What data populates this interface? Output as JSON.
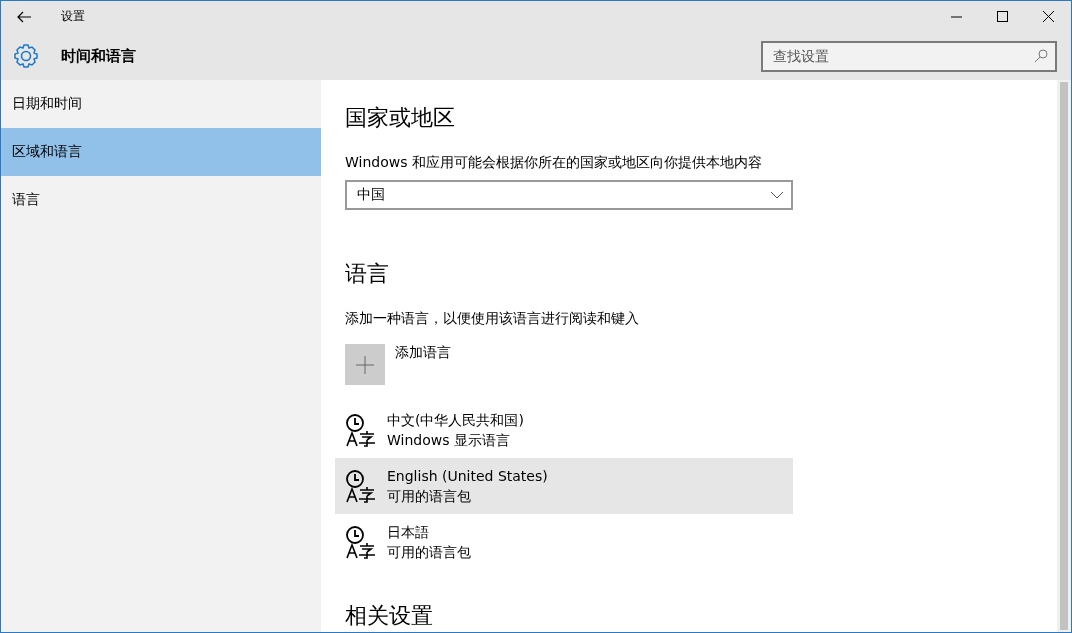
{
  "window": {
    "title": "设置"
  },
  "header": {
    "title": "时间和语言",
    "search": {
      "placeholder": "查找设置"
    }
  },
  "sidebar": {
    "items": [
      {
        "label": "日期和时间",
        "selected": false
      },
      {
        "label": "区域和语言",
        "selected": true
      },
      {
        "label": "语言",
        "selected": false
      }
    ]
  },
  "region": {
    "heading": "国家或地区",
    "description": "Windows 和应用可能会根据你所在的国家或地区向你提供本地内容",
    "dropdown": {
      "value": "中国"
    }
  },
  "language": {
    "heading": "语言",
    "description": "添加一种语言，以便使用该语言进行阅读和键入",
    "add_button": "添加语言",
    "items": [
      {
        "name": "中文(中华人民共和国)",
        "status": "Windows 显示语言",
        "selected": false
      },
      {
        "name": "English (United States)",
        "status": "可用的语言包",
        "selected": true
      },
      {
        "name": "日本語",
        "status": "可用的语言包",
        "selected": false
      }
    ]
  },
  "related": {
    "heading": "相关设置"
  }
}
